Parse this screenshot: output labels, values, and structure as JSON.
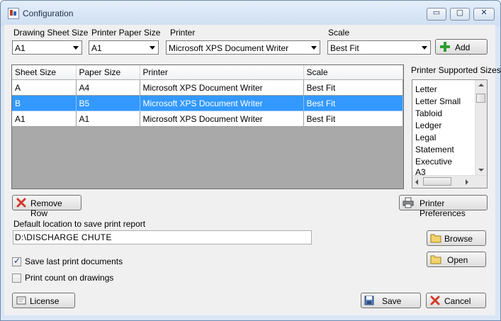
{
  "window": {
    "title": "Configuration",
    "controls": {
      "minimize": "▭",
      "maximize": "▢",
      "close": "✕"
    }
  },
  "selectors": {
    "drawing_sheet_size": {
      "label": "Drawing Sheet Size",
      "value": "A1"
    },
    "printer_paper_size": {
      "label": "Printer Paper Size",
      "value": "A1"
    },
    "printer": {
      "label": "Printer",
      "value": "Microsoft XPS Document Writer"
    },
    "scale": {
      "label": "Scale",
      "value": "Best Fit"
    }
  },
  "add_button": {
    "label": "Add"
  },
  "table": {
    "columns": [
      "Sheet Size",
      "Paper Size",
      "Printer",
      "Scale"
    ],
    "rows": [
      [
        "A",
        "A4",
        "Microsoft XPS Document Writer",
        "Best Fit"
      ],
      [
        "B",
        "B5",
        "Microsoft XPS Document Writer",
        "Best Fit"
      ],
      [
        "A1",
        "A1",
        "Microsoft XPS Document Writer",
        "Best Fit"
      ]
    ],
    "selected_row": 1
  },
  "supported_sizes": {
    "label": "Printer Supported Sizes",
    "items": [
      "Letter",
      "Letter Small",
      "Tabloid",
      "Ledger",
      "Legal",
      "Statement",
      "Executive",
      "A3"
    ]
  },
  "buttons": {
    "remove_row": "Remove Row",
    "printer_preferences": "Printer Preferences",
    "browse": "Browse",
    "open": "Open",
    "license": "License",
    "save": "Save",
    "cancel": "Cancel"
  },
  "report_location": {
    "label": "Default location to save print report",
    "value": "D:\\DISCHARGE CHUTE"
  },
  "options": {
    "save_last": {
      "label": "Save last print documents",
      "checked": true
    },
    "print_count": {
      "label": "Print count on drawings",
      "checked": false
    }
  },
  "colors": {
    "selection": "#3399ff",
    "grid_background": "#a9a9a9",
    "window_frame": "#d9e6f5"
  }
}
